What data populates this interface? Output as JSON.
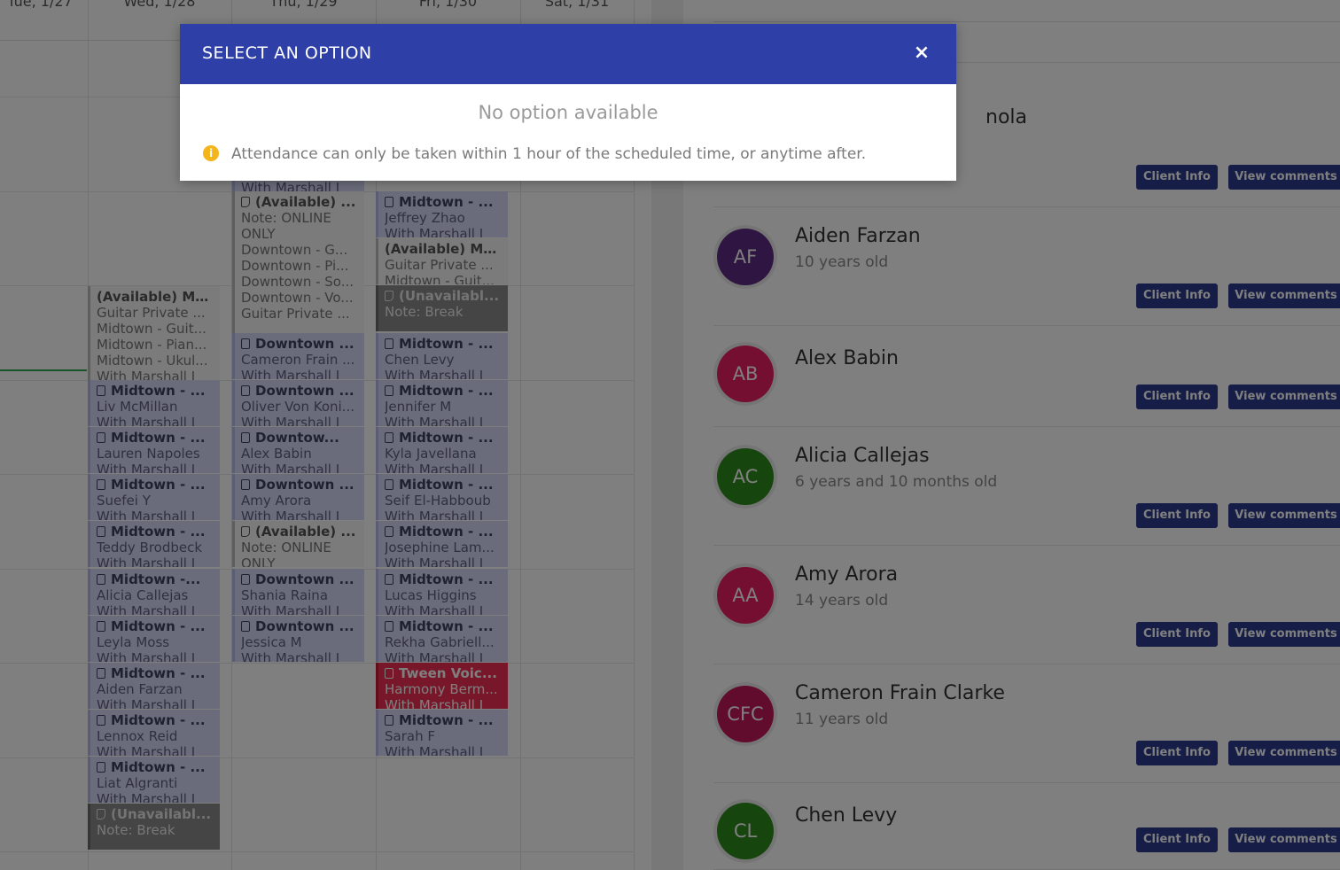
{
  "calendar": {
    "days": [
      "Tue, 1/27",
      "Wed, 1/28",
      "Thu, 1/29",
      "Fri, 1/30",
      "Sat, 1/31"
    ],
    "wed": [
      {
        "kind": "avail",
        "title": "(Available) Ma...",
        "lines": [
          "Guitar Private ...",
          "Midtown - Guit...",
          "Midtown - Pian...",
          "Midtown - Ukul...",
          "With Marshall J"
        ]
      },
      {
        "kind": "lesson",
        "title": "Midtown - ...",
        "lines": [
          "Liv McMillan",
          "With Marshall J"
        ]
      },
      {
        "kind": "lesson",
        "title": "Midtown - ...",
        "lines": [
          "Lauren Napoles",
          "With Marshall J"
        ]
      },
      {
        "kind": "lesson",
        "title": "Midtown - ...",
        "lines": [
          "Suefei Y",
          "With Marshall J"
        ]
      },
      {
        "kind": "lesson",
        "title": "Midtown - ...",
        "lines": [
          "Teddy Brodbeck",
          "With Marshall J"
        ]
      },
      {
        "kind": "lesson",
        "title": "Midtown -...",
        "lines": [
          "Alicia Callejas",
          "With Marshall J"
        ]
      },
      {
        "kind": "lesson",
        "title": "Midtown - ...",
        "lines": [
          "Leyla Moss",
          "With Marshall J"
        ]
      },
      {
        "kind": "lesson",
        "title": "Midtown - ...",
        "lines": [
          "Aiden Farzan",
          "With Marshall J"
        ]
      },
      {
        "kind": "lesson",
        "title": "Midtown - ...",
        "lines": [
          "Lennox Reid",
          "With Marshall J"
        ]
      },
      {
        "kind": "lesson",
        "title": "Midtown - ...",
        "lines": [
          "Liat Algranti",
          "With Marshall J"
        ]
      },
      {
        "kind": "unavail",
        "title": "(Unavailabl...",
        "lines": [
          "Note: Break"
        ]
      }
    ],
    "thu": [
      {
        "kind": "lesson",
        "title": "",
        "lines": [
          "With Marshall J"
        ]
      },
      {
        "kind": "avail",
        "title": "(Available) ...",
        "lines": [
          "Note: ONLINE",
          "ONLY",
          "Downtown - G...",
          "Downtown - Pi...",
          "Downtown - So...",
          "Downtown - Vo...",
          "Guitar Private ..."
        ]
      },
      {
        "kind": "lesson",
        "title": "Downtown ...",
        "lines": [
          "Cameron Frain ...",
          "With Marshall J"
        ]
      },
      {
        "kind": "lesson",
        "title": "Downtown ...",
        "lines": [
          "Oliver Von Koni...",
          "With Marshall J"
        ]
      },
      {
        "kind": "lesson",
        "title": "Downtow...",
        "lines": [
          "Alex Babin",
          "With Marshall J"
        ]
      },
      {
        "kind": "lesson",
        "title": "Downtown ...",
        "lines": [
          "Amy Arora",
          "With Marshall J"
        ]
      },
      {
        "kind": "avail",
        "title": "(Available) ...",
        "lines": [
          "Note: ONLINE",
          "ONLY"
        ]
      },
      {
        "kind": "lesson",
        "title": "Downtown ...",
        "lines": [
          "Shania Raina",
          "With Marshall J"
        ]
      },
      {
        "kind": "lesson",
        "title": "Downtown ...",
        "lines": [
          "Jessica M",
          "With Marshall J"
        ]
      }
    ],
    "fri": [
      {
        "kind": "lesson",
        "title": "Midtown - ...",
        "lines": [
          "Jeffrey Zhao",
          "With Marshall J"
        ]
      },
      {
        "kind": "avail",
        "title": "(Available) Ma...",
        "lines": [
          "Guitar Private ...",
          "Midtown - Guit..."
        ]
      },
      {
        "kind": "unavail",
        "title": "(Unavailabl...",
        "lines": [
          "Note: Break"
        ]
      },
      {
        "kind": "lesson",
        "title": "Midtown - ...",
        "lines": [
          "Chen Levy",
          "With Marshall J"
        ]
      },
      {
        "kind": "lesson",
        "title": "Midtown - ...",
        "lines": [
          "Jennifer M",
          "With Marshall J"
        ]
      },
      {
        "kind": "lesson",
        "title": "Midtown - ...",
        "lines": [
          "Kyla Javellana",
          "With Marshall J"
        ]
      },
      {
        "kind": "lesson",
        "title": "Midtown - ...",
        "lines": [
          "Seif El-Habboub",
          "With Marshall J"
        ]
      },
      {
        "kind": "lesson",
        "title": "Midtown - ...",
        "lines": [
          "Josephine Lam...",
          "With Marshall J"
        ]
      },
      {
        "kind": "lesson",
        "title": "Midtown - ...",
        "lines": [
          "Lucas Higgins",
          "With Marshall J"
        ]
      },
      {
        "kind": "lesson",
        "title": "Midtown - ...",
        "lines": [
          "Rekha Gabriell...",
          "With Marshall J"
        ]
      },
      {
        "kind": "red",
        "title": "Tween Voic...",
        "lines": [
          "Harmony Berm...",
          "With Marshall J"
        ]
      },
      {
        "kind": "lesson",
        "title": "Midtown - ...",
        "lines": [
          "Sarah F",
          "With Marshall J"
        ]
      }
    ]
  },
  "clients": {
    "partial_name": "nola",
    "button_info": "Client Info",
    "button_comments": "View comments",
    "list": [
      {
        "initials": "AF",
        "name": "Aiden Farzan",
        "age": "10 years old",
        "color": "#5e2a84"
      },
      {
        "initials": "AB",
        "name": "Alex Babin",
        "age": "",
        "color": "#e91e63"
      },
      {
        "initials": "AC",
        "name": "Alicia Callejas",
        "age": "6 years and 10 months old",
        "color": "#2e8b1c"
      },
      {
        "initials": "AA",
        "name": "Amy Arora",
        "age": "14 years old",
        "color": "#e91e63"
      },
      {
        "initials": "CFC",
        "name": "Cameron Frain Clarke",
        "age": "11 years old",
        "color": "#c2185b"
      },
      {
        "initials": "CL",
        "name": "Chen Levy",
        "age": "",
        "color": "#2e8b1c"
      }
    ]
  },
  "modal": {
    "title": "SELECT AN OPTION",
    "close": "×",
    "empty_text": "No option available",
    "info_icon": "i",
    "info_text": "Attendance can only be taken within 1 hour of the scheduled time, or anytime after."
  }
}
